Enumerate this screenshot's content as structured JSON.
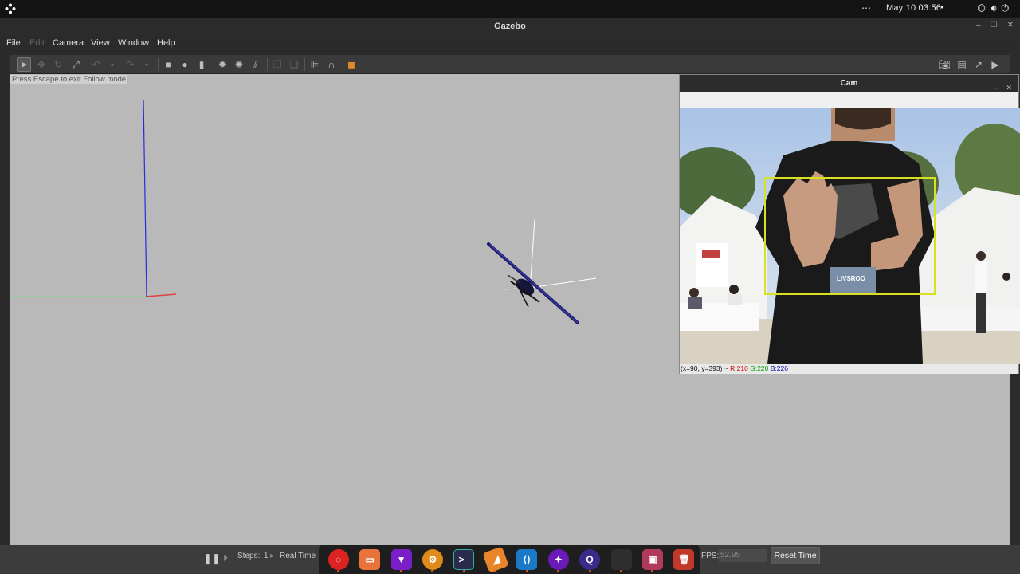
{
  "system": {
    "clock": "May 10  03:56"
  },
  "window": {
    "title": "Gazebo"
  },
  "menu": {
    "file": "File",
    "edit": "Edit",
    "camera": "Camera",
    "view": "View",
    "window": "Window",
    "help": "Help"
  },
  "viewport": {
    "hint": "Press Escape to exit Follow mode"
  },
  "bottom": {
    "steps_label": "Steps:",
    "steps_value": "1",
    "real_time_label": "Real Time",
    "fps_label": "FPS:",
    "fps_value": "52.95",
    "reset_label": "Reset Time"
  },
  "cam_window": {
    "title": "Cam",
    "badge_text": "LIVSROO",
    "status_coords": "(x=90, y=393) ~",
    "status_r": "R:210",
    "status_g": "G:220",
    "status_b": "B:226"
  },
  "dock": {
    "items": [
      "ubuntu-installer",
      "files",
      "brave",
      "settings",
      "terminal",
      "blender",
      "vscode",
      "app-purple",
      "qgroundcontrol",
      "blank",
      "screen-recorder",
      "trash"
    ]
  },
  "colors": {
    "viewport_bg": "#b9b9b9",
    "accent": "#e95420",
    "bbox": "#d8e020"
  }
}
